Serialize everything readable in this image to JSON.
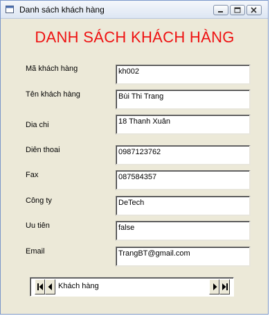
{
  "window": {
    "title": "Danh sách khách hàng",
    "controls": [
      "minimize-icon",
      "maximize-icon",
      "close-icon"
    ]
  },
  "form": {
    "heading": "DANH SÁCH KHÁCH HÀNG",
    "heading_color": "#ee1111",
    "fields": [
      {
        "label": "Mã khách hàng",
        "value": "kh002"
      },
      {
        "label": "Tên khách hàng",
        "value": "Bùi Thi Trang"
      },
      {
        "label": "Dia chi",
        "value": "18 Thanh Xuân"
      },
      {
        "label": "Diên thoai",
        "value": "0987123762"
      },
      {
        "label": "Fax",
        "value": "087584357"
      },
      {
        "label": "Công ty",
        "value": "DeTech"
      },
      {
        "label": "Uu tiên",
        "value": "false"
      },
      {
        "label": "Email",
        "value": "TrangBT@gmail.com"
      }
    ]
  },
  "navigator": {
    "caption": "Khách hàng",
    "buttons": [
      "first-record-icon",
      "previous-record-icon",
      "next-record-icon",
      "last-record-icon"
    ]
  }
}
